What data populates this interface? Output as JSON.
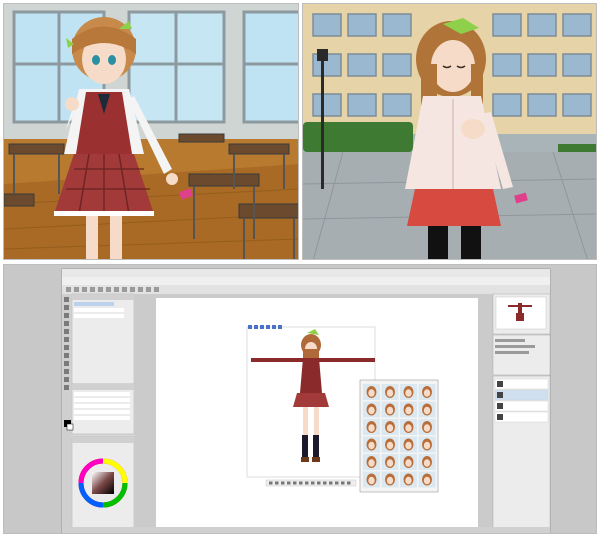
{
  "illustration_panels": [
    {
      "name": "classroom-scene",
      "description_visible": false
    },
    {
      "name": "courtyard-scene",
      "description_visible": false
    }
  ],
  "app_window": {
    "title": "",
    "menu_items": [],
    "tool_property_panel": {
      "title": "",
      "items": [
        "",
        "",
        "",
        ""
      ]
    },
    "layer_panel": {
      "title": "",
      "items": [
        "",
        "",
        "",
        "",
        ""
      ]
    },
    "color_wheel": {
      "selected_color": "#5a3a3a"
    },
    "canvas": {
      "top_toolbar_icons": 6,
      "bottom_toolbar_icons": 14,
      "pose_thumbnails": 24
    },
    "navigator": {
      "title": ""
    },
    "right_layers": {
      "items": [
        "",
        "",
        "",
        "",
        "",
        ""
      ]
    }
  },
  "colors": {
    "app_chrome": "#d8d8d8",
    "canvas_bg": "#ffffff",
    "accent_red": "#8b2a2a",
    "uniform_plaid": "#a23a3a"
  }
}
